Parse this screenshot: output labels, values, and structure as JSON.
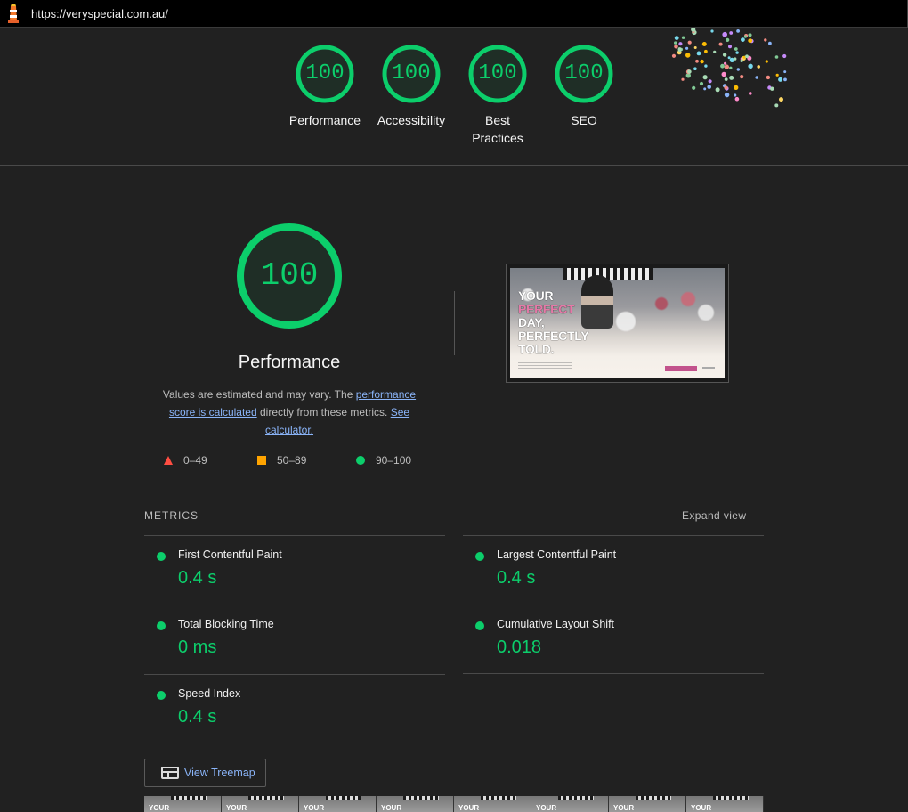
{
  "browser": {
    "url": "https://veryspecial.com.au/"
  },
  "summary": {
    "scores": [
      {
        "label": "Performance",
        "label2": "",
        "score": "100"
      },
      {
        "label": "Accessibility",
        "label2": "",
        "score": "100"
      },
      {
        "label": "Best",
        "label2": "Practices",
        "score": "100"
      },
      {
        "label": "SEO",
        "label2": "",
        "score": "100"
      }
    ]
  },
  "performance": {
    "score": "100",
    "title": "Performance",
    "desc_prefix": "Values are estimated and may vary. The ",
    "desc_link1": "performance score is calculated",
    "desc_mid": " directly from these metrics. ",
    "desc_link2": "See calculator.",
    "legend": [
      {
        "range": "0–49",
        "color": "#ff4e42"
      },
      {
        "range": "50–89",
        "color": "#ffa400"
      },
      {
        "range": "90–100",
        "color": "#0cce6b"
      }
    ]
  },
  "screenshot": {
    "line1": "YOUR",
    "line2": "PERFECT",
    "line3": "DAY,",
    "line4": "PERFECTLY",
    "line5": "TOLD."
  },
  "metrics": {
    "heading": "METRICS",
    "expand_label": "Expand view",
    "items": [
      {
        "name": "First Contentful Paint",
        "value": "0.4 s"
      },
      {
        "name": "Largest Contentful Paint",
        "value": "0.4 s"
      },
      {
        "name": "Total Blocking Time",
        "value": "0 ms"
      },
      {
        "name": "Cumulative Layout Shift",
        "value": "0.018"
      },
      {
        "name": "Speed Index",
        "value": "0.4 s"
      }
    ]
  },
  "treemap": {
    "label": "View Treemap"
  },
  "filmstrip": {
    "frame_text": "YOUR"
  },
  "colors": {
    "pass": "#0cce6b",
    "average": "#ffa400",
    "fail": "#ff4e42",
    "link": "#8ab4f8"
  }
}
